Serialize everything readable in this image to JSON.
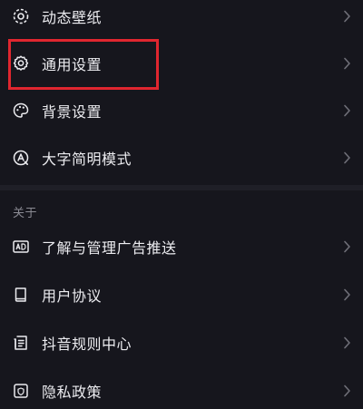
{
  "settings": {
    "items": [
      {
        "label": "动态壁纸",
        "icon": "live-wallpaper-icon"
      },
      {
        "label": "通用设置",
        "icon": "gear-icon"
      },
      {
        "label": "背景设置",
        "icon": "palette-icon"
      },
      {
        "label": "大字简明模式",
        "icon": "large-font-icon"
      }
    ]
  },
  "about": {
    "title": "关于",
    "items": [
      {
        "label": "了解与管理广告推送",
        "icon": "ad-icon"
      },
      {
        "label": "用户协议",
        "icon": "book-icon"
      },
      {
        "label": "抖音规则中心",
        "icon": "document-list-icon"
      },
      {
        "label": "隐私政策",
        "icon": "shield-icon"
      }
    ]
  },
  "colors": {
    "background": "#16161d",
    "text": "#ececf0",
    "secondary_text": "#8a8a93",
    "highlight": "#e0262f"
  }
}
